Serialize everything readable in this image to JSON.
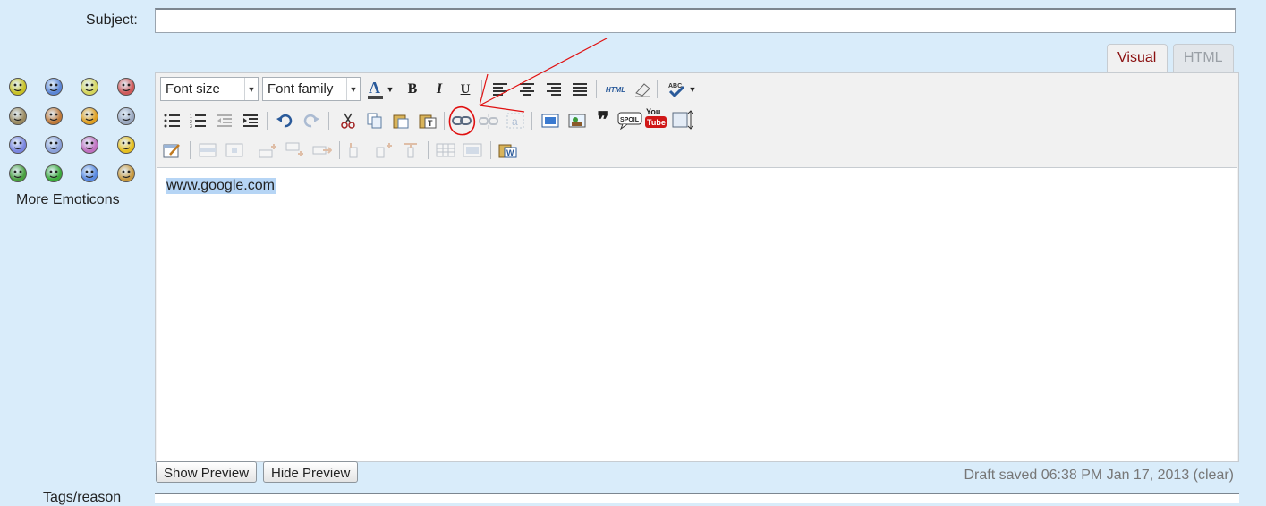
{
  "subject": {
    "label": "Subject:",
    "value": ""
  },
  "tabs": [
    {
      "label": "Visual",
      "active": true
    },
    {
      "label": "HTML",
      "active": false
    }
  ],
  "toolbar": {
    "font_size": "Font size",
    "font_family": "Font family",
    "bold": "B",
    "italic": "I",
    "underline": "U",
    "html_label": "HTML"
  },
  "editor": {
    "content": "www.google.com"
  },
  "emoticons": {
    "colors": [
      "#c9c224",
      "#5b86d6",
      "#d6d65c",
      "#d05a5a",
      "#9a8a60",
      "#c07a3a",
      "#e0a020",
      "#9aa8c0",
      "#7a86e0",
      "#8aa0d8",
      "#c070c0",
      "#e6c020",
      "#4aa040",
      "#3caa3c",
      "#5a8ae0",
      "#c89a40"
    ],
    "more_label": "More Emoticons"
  },
  "buttons": {
    "show_preview": "Show Preview",
    "hide_preview": "Hide Preview"
  },
  "status": {
    "draft": "Draft saved 06:38 PM Jan 17, 2013 (clear)"
  },
  "bottom": {
    "label": "Tags/reason"
  },
  "colors": {
    "background": "#d9ecfa",
    "annotation": "#e01010",
    "active_tab": "#8a0f0f"
  }
}
